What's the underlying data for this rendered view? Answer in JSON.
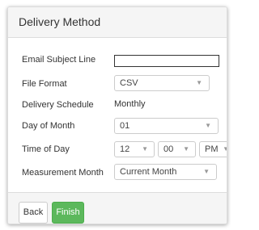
{
  "dialog": {
    "title": "Delivery Method"
  },
  "form": {
    "email_subject": {
      "label": "Email Subject Line",
      "value": ""
    },
    "file_format": {
      "label": "File Format",
      "value": "CSV"
    },
    "delivery_schedule": {
      "label": "Delivery Schedule",
      "value": "Monthly"
    },
    "day_of_month": {
      "label": "Day of Month",
      "value": "01"
    },
    "time_of_day": {
      "label": "Time of Day",
      "hour": "12",
      "minute": "00",
      "ampm": "PM"
    },
    "measurement_month": {
      "label": "Measurement Month",
      "value": "Current Month"
    }
  },
  "footer": {
    "back_label": "Back",
    "finish_label": "Finish"
  },
  "colors": {
    "finish_button": "#5cb85c",
    "header_bg": "#f5f5f5"
  },
  "icons": {
    "dropdown": "chevron-down-icon"
  }
}
